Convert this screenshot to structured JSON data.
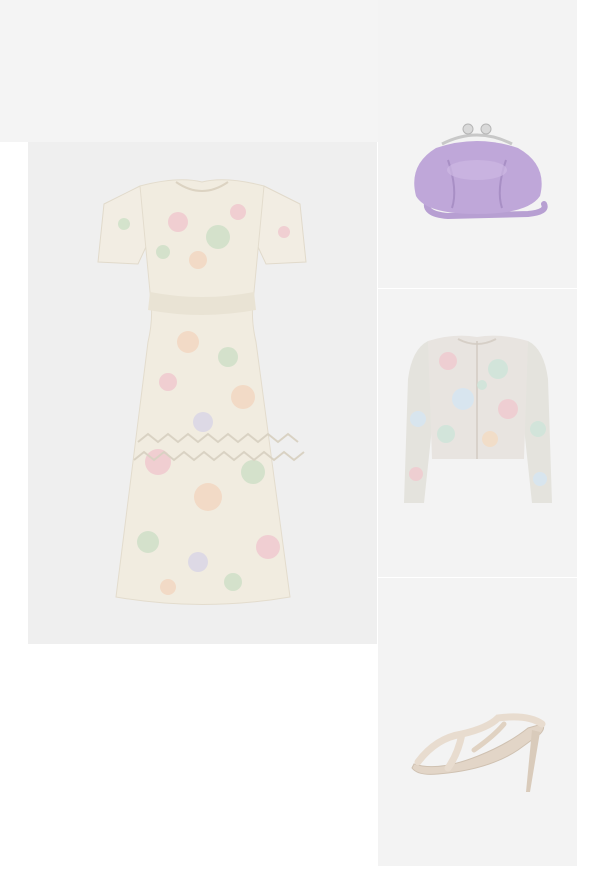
{
  "colors": {
    "panel_bg": "#efefef",
    "dress_base": "#f1ece0",
    "bag_lilac": "#bfa7d9",
    "bag_clasp": "#cfcfcf",
    "jacket_base": "#e8e4e0",
    "shoe_satin": "#e8dccf"
  },
  "outfit": {
    "items": [
      {
        "id": "dress",
        "icon": "dress-icon"
      },
      {
        "id": "bag",
        "icon": "purse-icon"
      },
      {
        "id": "jacket",
        "icon": "jacket-icon"
      },
      {
        "id": "shoe",
        "icon": "heel-sandal-icon"
      }
    ]
  }
}
